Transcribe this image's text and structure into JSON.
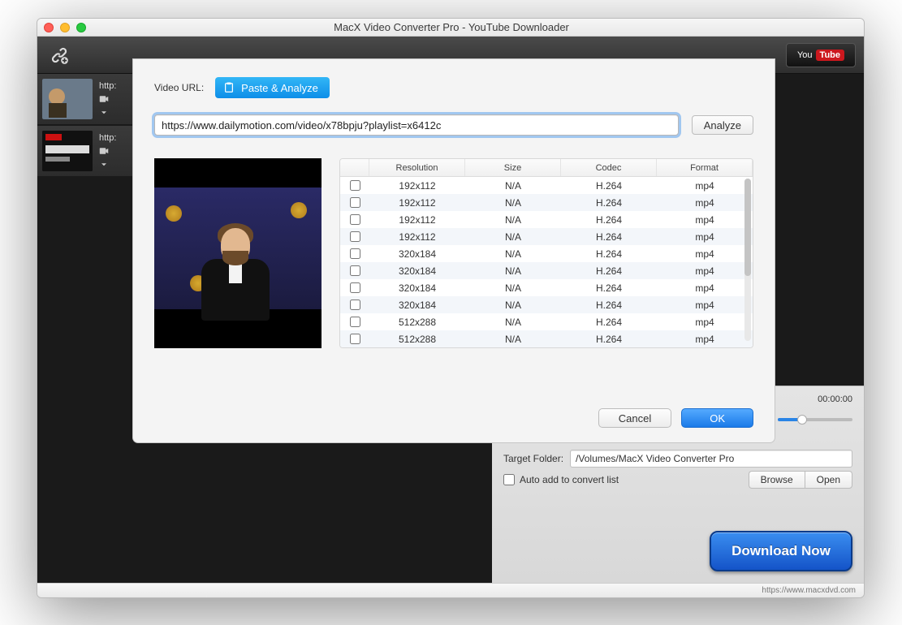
{
  "window": {
    "title": "MacX Video Converter Pro - YouTube Downloader",
    "status_url": "https://www.macxdvd.com"
  },
  "toolbar": {
    "youtube_label_you": "You",
    "youtube_label_tube": "Tube"
  },
  "queue": [
    {
      "url": "http:"
    },
    {
      "url": "http:"
    }
  ],
  "player": {
    "timecode": "00:00:00"
  },
  "target": {
    "label": "Target Folder:",
    "path": "/Volumes/MacX Video Converter Pro",
    "auto_label": "Auto add to convert list",
    "browse": "Browse",
    "open": "Open"
  },
  "download_button": "Download Now",
  "modal": {
    "url_label": "Video URL:",
    "paste_label": "Paste & Analyze",
    "url_value": "https://www.dailymotion.com/video/x78bpju?playlist=x6412c",
    "analyze": "Analyze",
    "cancel": "Cancel",
    "ok": "OK",
    "columns": {
      "c0": "",
      "c1": "Resolution",
      "c2": "Size",
      "c3": "Codec",
      "c4": "Format"
    },
    "rows": [
      {
        "resolution": "192x112",
        "size": "N/A",
        "codec": "H.264",
        "format": "mp4"
      },
      {
        "resolution": "192x112",
        "size": "N/A",
        "codec": "H.264",
        "format": "mp4"
      },
      {
        "resolution": "192x112",
        "size": "N/A",
        "codec": "H.264",
        "format": "mp4"
      },
      {
        "resolution": "192x112",
        "size": "N/A",
        "codec": "H.264",
        "format": "mp4"
      },
      {
        "resolution": "320x184",
        "size": "N/A",
        "codec": "H.264",
        "format": "mp4"
      },
      {
        "resolution": "320x184",
        "size": "N/A",
        "codec": "H.264",
        "format": "mp4"
      },
      {
        "resolution": "320x184",
        "size": "N/A",
        "codec": "H.264",
        "format": "mp4"
      },
      {
        "resolution": "320x184",
        "size": "N/A",
        "codec": "H.264",
        "format": "mp4"
      },
      {
        "resolution": "512x288",
        "size": "N/A",
        "codec": "H.264",
        "format": "mp4"
      },
      {
        "resolution": "512x288",
        "size": "N/A",
        "codec": "H.264",
        "format": "mp4"
      }
    ]
  }
}
